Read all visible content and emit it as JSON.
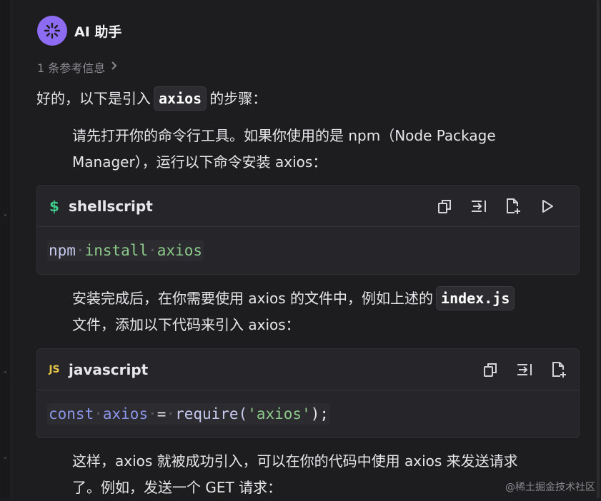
{
  "assistant": {
    "name": "AI 助手",
    "references": "1 条参考信息"
  },
  "intro": {
    "before": "好的，以下是引入",
    "code": "axios",
    "after": "的步骤："
  },
  "step1": {
    "line1": "请先打开你的命令行工具。如果你使用的是 npm（Node Package",
    "line2": "Manager），运行以下命令安装 axios："
  },
  "code1": {
    "language": "shellscript",
    "icon": "$",
    "tokens": [
      "npm",
      "install",
      "axios"
    ]
  },
  "step2": {
    "line1": "安装完成后，在你需要使用 axios 的文件中，例如上述的",
    "code": "index.js",
    "line2": "文件，添加以下代码来引入 axios："
  },
  "code2": {
    "language": "javascript",
    "icon": "JS",
    "tokens": [
      "const",
      "axios",
      "=",
      "require(",
      "'axios'",
      ");"
    ]
  },
  "step3": {
    "line1": "这样，axios 就被成功引入，可以在你的代码中使用 axios 来发送请求",
    "line2": "了。例如，发送一个 GET 请求："
  },
  "watermark": "@稀土掘金技术社区",
  "colors": {
    "background": "#1d1d20",
    "avatar": "#8d6cf3",
    "code_block": "#25252a",
    "shell_icon": "#3fc98a",
    "js_icon": "#e5c548"
  },
  "icons": {
    "copy": "copy-icon",
    "insert": "insert-icon",
    "new_file": "new-file-icon",
    "run": "run-icon"
  }
}
